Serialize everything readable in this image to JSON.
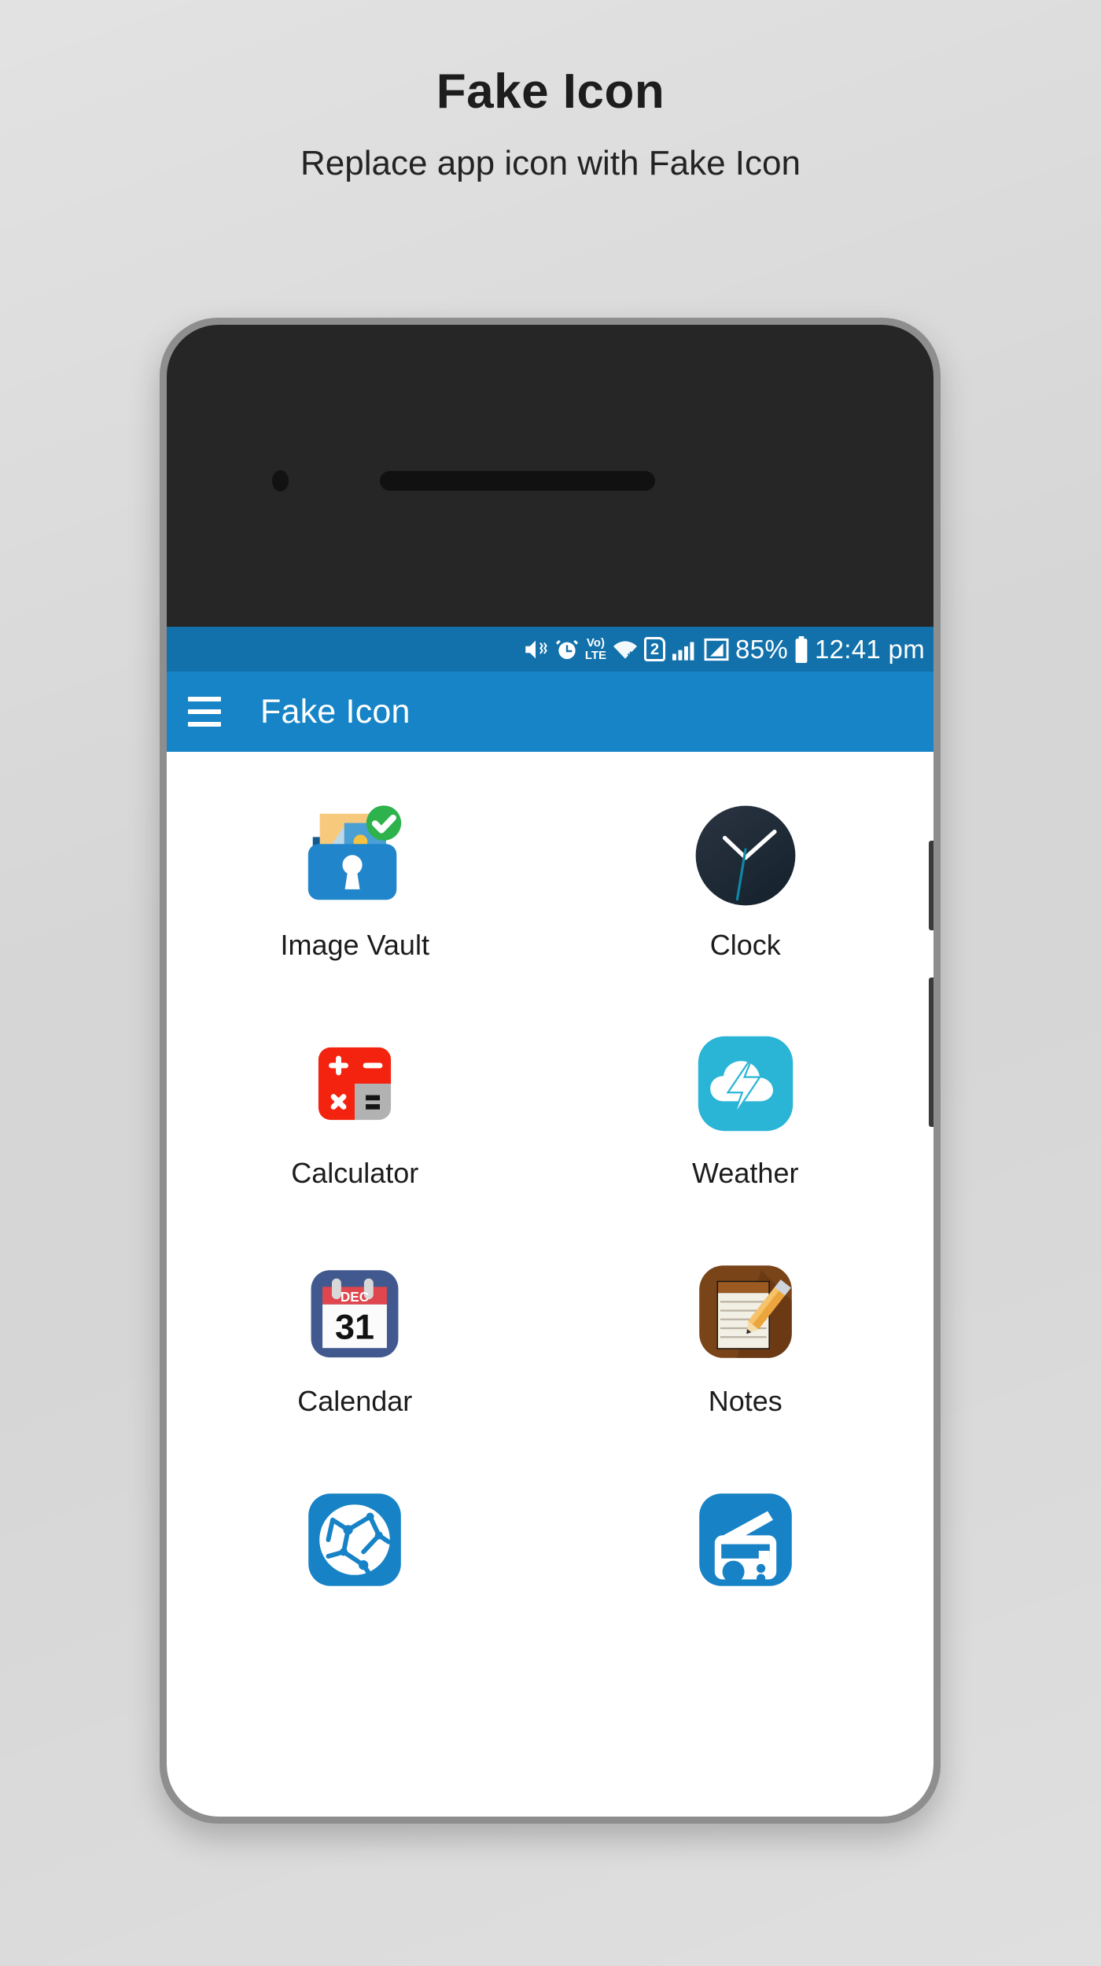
{
  "promo": {
    "title": "Fake Icon",
    "subtitle": "Replace app icon with Fake Icon"
  },
  "colors": {
    "background": "#d6d6d6",
    "status_bar": "#1271ab",
    "app_bar": "#1684c6",
    "screen": "#ffffff",
    "phone_frame": "#8e8e8e",
    "phone_body": "#262626",
    "label_text": "#1c1c1c"
  },
  "status_bar": {
    "icons": [
      "mute-vibrate-icon",
      "alarm-clock-icon",
      "volte-icon",
      "wifi-icon",
      "sim-2-icon",
      "signal-bars-icon",
      "signal-strength-icon"
    ],
    "volte_top": "Vo)",
    "volte_bottom": "LTE",
    "sim_label": "2",
    "battery_percent": "85%",
    "time": "12:41 pm"
  },
  "app_bar": {
    "menu_icon": "hamburger-menu-icon",
    "title": "Fake Icon"
  },
  "app_grid": {
    "items": [
      {
        "label": "Image Vault",
        "icon": "image-vault-icon"
      },
      {
        "label": "Clock",
        "icon": "clock-icon"
      },
      {
        "label": "Calculator",
        "icon": "calculator-icon"
      },
      {
        "label": "Weather",
        "icon": "weather-icon"
      },
      {
        "label": "Calendar",
        "icon": "calendar-icon"
      },
      {
        "label": "Notes",
        "icon": "notes-icon"
      },
      {
        "label": "",
        "icon": "browser-globe-icon"
      },
      {
        "label": "",
        "icon": "radio-icon"
      }
    ]
  },
  "calculator_icon": {
    "plus": "+",
    "minus": "−",
    "times": "×",
    "equals": "="
  },
  "calendar_icon": {
    "month": "DEC",
    "day": "31"
  }
}
